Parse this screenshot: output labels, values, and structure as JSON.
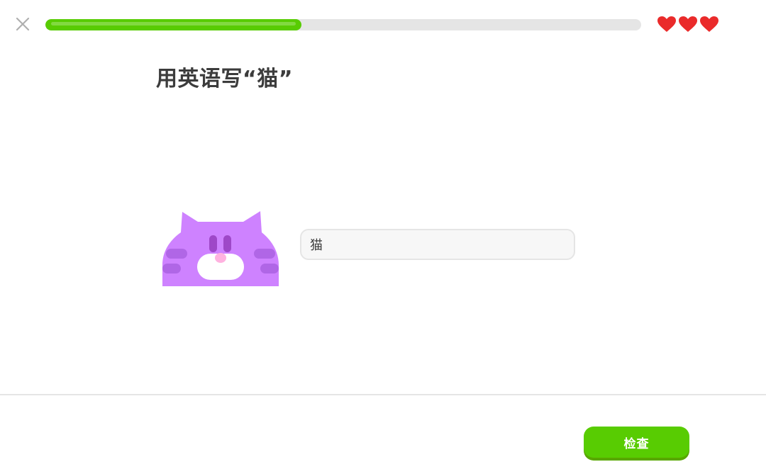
{
  "header": {
    "close_icon": "close-icon",
    "progress": {
      "value": 0.43,
      "track_color": "#e5e5e5",
      "fill_color": "#58cc02"
    },
    "hearts": {
      "count": 3,
      "icon": "heart-icon",
      "color": "#ea2b2b"
    }
  },
  "challenge": {
    "title": "用英语写“猫”",
    "character": "cat-illustration",
    "bubble_text": "猫"
  },
  "footer": {
    "check_label": "检查",
    "button_color": "#58cc02"
  }
}
